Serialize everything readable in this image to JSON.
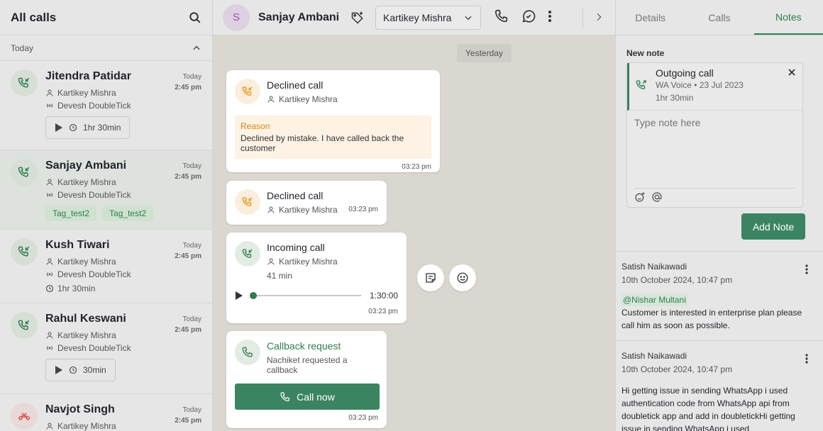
{
  "left": {
    "title": "All calls",
    "section": "Today",
    "calls": [
      {
        "name": "Jitendra Patidar",
        "day": "Today",
        "time": "2:45 pm",
        "agent": "Kartikey Mishra",
        "number": "Devesh DoubleTick",
        "duration": "1hr 30min"
      },
      {
        "name": "Sanjay Ambani",
        "day": "Today",
        "time": "2:45 pm",
        "agent": "Kartikey Mishra",
        "number": "Devesh DoubleTick",
        "tags": [
          "Tag_test2",
          "Tag_test2"
        ]
      },
      {
        "name": "Kush Tiwari",
        "day": "Today",
        "time": "2:45 pm",
        "agent": "Kartikey Mishra",
        "number": "Devesh DoubleTick",
        "duration": "1hr 30min"
      },
      {
        "name": "Rahul Keswani",
        "day": "Today",
        "time": "2:45 pm",
        "agent": "Kartikey Mishra",
        "number": "Devesh DoubleTick",
        "duration": "30min"
      },
      {
        "name": "Navjot Singh",
        "day": "Today",
        "time": "2:45 pm",
        "agent": "Kartikey Mishra"
      }
    ]
  },
  "header": {
    "avatar_letter": "S",
    "contact_name": "Sanjay Ambani",
    "agent_select": "Kartikey Mishra"
  },
  "chat": {
    "date_pill": "Yesterday",
    "messages": [
      {
        "title": "Declined call",
        "agent": "Kartikey Mishra",
        "reason_label": "Reason",
        "reason_text": "Declined by mistake. I have called back the customer",
        "time": "03:23 pm"
      },
      {
        "title": "Declined call",
        "agent": "Kartikey Mishra",
        "time": "03:23 pm"
      },
      {
        "title": "Incoming call",
        "agent": "Kartikey Mishra",
        "duration": "41 min",
        "audio_length": "1:30:00",
        "time": "03:23 pm"
      },
      {
        "title": "Callback request",
        "subtitle": "Nachiket requested a callback",
        "button": "Call now",
        "time": "03:23 pm"
      }
    ]
  },
  "right": {
    "tabs": [
      "Details",
      "Calls",
      "Notes"
    ],
    "new_note_label": "New note",
    "ref": {
      "title": "Outgoing call",
      "sub": "WA Voice • 23 Jul 2023",
      "duration": "1hr 30min"
    },
    "note_placeholder": "Type note here",
    "add_button": "Add Note",
    "notes": [
      {
        "author": "Satish Naikawadi",
        "date": "10th October 2024, 10:47 pm",
        "mention": "@Nishar Multani",
        "text": "Customer is interested in enterprise plan please call him as soon as possible."
      },
      {
        "author": "Satish Naikawadi",
        "date": "10th October 2024, 10:47 pm",
        "text": "Hi getting issue in sending WhatsApp i used authentication code from WhatsApp api from doubletick app and add in doubletickHi getting issue in sending WhatsApp i used"
      }
    ]
  },
  "colors": {
    "accent": "#3b8461",
    "declined": "#e8920f",
    "missed": "#d9534f"
  }
}
